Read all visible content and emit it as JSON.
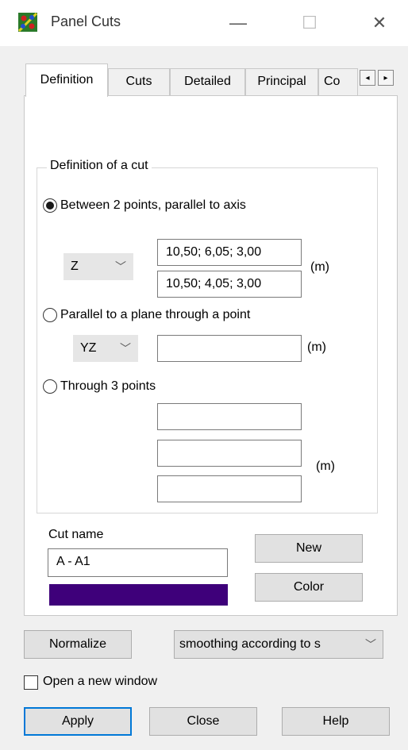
{
  "window": {
    "title": "Panel Cuts",
    "minimize_glyph": "—",
    "maximize_glyph": "☐",
    "close_glyph": "✕"
  },
  "tabs": [
    {
      "label": "Definition",
      "active": true
    },
    {
      "label": "Cuts",
      "active": false
    },
    {
      "label": "Detailed",
      "active": false
    },
    {
      "label": "Principal",
      "active": false
    },
    {
      "label": "Co",
      "active": false
    }
  ],
  "tab_scroll": {
    "left": "◂",
    "right": "▸"
  },
  "definition": {
    "group_title": "Definition of a cut",
    "option1": {
      "label": "Between 2 points, parallel to axis",
      "selected": true,
      "axis": "Z",
      "point1": "10,50; 6,05; 3,00",
      "point2": "10,50; 4,05; 3,00",
      "unit": "(m)"
    },
    "option2": {
      "label": "Parallel to a plane through a point",
      "selected": false,
      "plane": "YZ",
      "point": "",
      "unit": "(m)"
    },
    "option3": {
      "label": "Through 3 points",
      "selected": false,
      "point1": "",
      "point2": "",
      "point3": "",
      "unit": "(m)"
    },
    "cut_name_label": "Cut name",
    "cut_name": "A - A1",
    "cut_color": "#3e007a",
    "new_label": "New",
    "color_label": "Color"
  },
  "bottom": {
    "normalize_label": "Normalize",
    "smoothing_value": "smoothing according to s",
    "open_new_window_label": "Open a new window",
    "open_new_window_checked": false,
    "apply_label": "Apply",
    "close_label": "Close",
    "help_label": "Help"
  },
  "colors": {
    "accent": "#0078d7",
    "window_bg": "#f0f0f0",
    "panel_bg": "#ffffff"
  }
}
